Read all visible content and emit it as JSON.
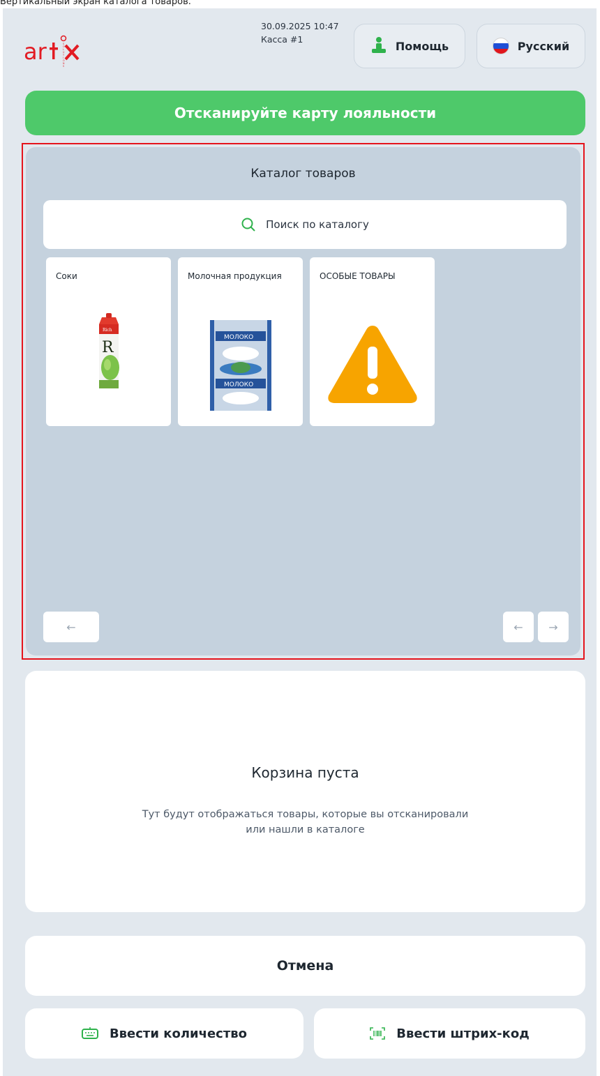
{
  "caption": "Вертикальный экран каталога товаров.",
  "brand": {
    "logo_text": "artx",
    "logo_subtext": "SOLUTIONS",
    "accent": "#e21b23"
  },
  "header": {
    "datetime": "30.09.2025 10:47",
    "register": "Касса #1",
    "help_label": "Помощь",
    "language_label": "Русский"
  },
  "loyalty": {
    "label": "Отсканируйте карту лояльности",
    "color": "#4ec96a"
  },
  "catalog": {
    "title": "Каталог товаров",
    "search_placeholder": "Поиск по каталогу",
    "categories": [
      {
        "label": "Соки",
        "icon": "juice-carton-image"
      },
      {
        "label": "Молочная продукция",
        "icon": "milk-package-image"
      },
      {
        "label": "ОСОБЫЕ ТОВАРЫ",
        "icon": "warning-triangle-icon"
      }
    ],
    "pager": {
      "prev_page": "←",
      "prev": "←",
      "next": "→"
    }
  },
  "cart": {
    "title": "Корзина пуста",
    "description_line1": "Тут будут отображаться товары, которые вы отсканировали",
    "description_line2": "или нашли в каталоге"
  },
  "actions": {
    "cancel_label": "Отмена",
    "quantity_label": "Ввести количество",
    "barcode_label": "Ввести штрих-код"
  },
  "packaging_text": {
    "juice_brand": "Rich",
    "milk_label": "МОЛОКО"
  }
}
